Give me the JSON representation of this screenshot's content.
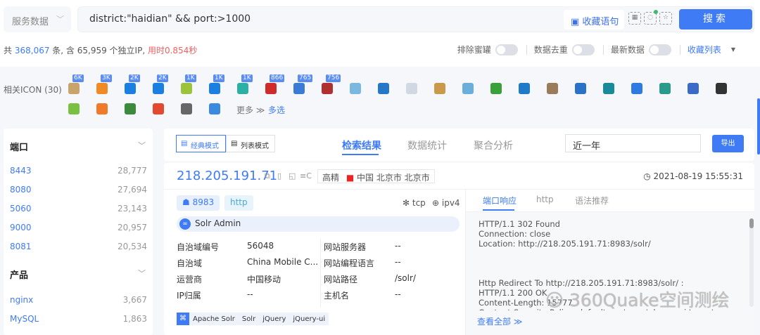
{
  "search": {
    "type_select": "服务数据",
    "query": "district:\"haidian\" && port:>1000",
    "fav_label": "收藏语句",
    "search_label": "搜索"
  },
  "stats": {
    "prefix": "共",
    "total": "368,067",
    "mid": "条, 含 65,959 个独立IP,",
    "time": "用时0.854秒"
  },
  "toggles": [
    {
      "label": "排除蜜罐",
      "on": false
    },
    {
      "label": "数据去重",
      "on": false
    },
    {
      "label": "最新数据",
      "on": false
    }
  ],
  "fav_list": "收藏列表",
  "icons": {
    "label": "相关ICON (30)",
    "more": "更多 ≫",
    "multi": "多选",
    "items": [
      {
        "badge": "6K",
        "color": "#c9a46a"
      },
      {
        "badge": "3K",
        "color": "#f08a24"
      },
      {
        "badge": "2K",
        "color": "#1a7fe0"
      },
      {
        "badge": "2K",
        "color": "#1a7fe0"
      },
      {
        "badge": "1K",
        "color": "#9bc43a"
      },
      {
        "badge": "1K",
        "color": "#1a7fe0"
      },
      {
        "badge": "1K",
        "color": "#2bb0a6"
      },
      {
        "badge": "866",
        "color": "#d02b2b"
      },
      {
        "badge": "765",
        "color": "#3a7bd5"
      },
      {
        "badge": "756",
        "color": "#b03030"
      },
      {
        "badge": "",
        "color": "#7ab8e0"
      },
      {
        "badge": "",
        "color": "#2577c8"
      },
      {
        "badge": "",
        "color": "#d0d8e4"
      },
      {
        "badge": "",
        "color": "#c89a4a"
      },
      {
        "badge": "",
        "color": "#6aaedc"
      },
      {
        "badge": "",
        "color": "#3aa03a"
      },
      {
        "badge": "",
        "color": "#1f7ac8"
      },
      {
        "badge": "",
        "color": "#9a7c5a"
      },
      {
        "badge": "",
        "color": "#2a72c8"
      },
      {
        "badge": "",
        "color": "#1a8a9a"
      },
      {
        "badge": "",
        "color": "#2d7be0"
      },
      {
        "badge": "",
        "color": "#2a9a8a"
      },
      {
        "badge": "",
        "color": "#3a6ac8"
      },
      {
        "badge": "",
        "color": "#333333"
      },
      {
        "badge": "",
        "color": "#7ac043"
      },
      {
        "badge": "",
        "color": "#f07a2a"
      },
      {
        "badge": "",
        "color": "#3c8a3c"
      },
      {
        "badge": "",
        "color": "#e2492f"
      },
      {
        "badge": "",
        "color": "#666666"
      },
      {
        "badge": "",
        "color": "#3a8ae0"
      }
    ]
  },
  "sidebar": {
    "port_title": "端口",
    "ports": [
      {
        "k": "8443",
        "v": "28,777"
      },
      {
        "k": "8080",
        "v": "27,694"
      },
      {
        "k": "5060",
        "v": "23,143"
      },
      {
        "k": "9000",
        "v": "20,957"
      },
      {
        "k": "8081",
        "v": "20,534"
      }
    ],
    "product_title": "产品",
    "products": [
      {
        "k": "nginx",
        "v": "3,667"
      },
      {
        "k": "MySQL",
        "v": "1,863"
      }
    ]
  },
  "toolbar": {
    "classic": "经典模式",
    "list": "列表模式",
    "tabs": [
      "检索结果",
      "数据统计",
      "聚合分析"
    ],
    "range": "近一年",
    "export": "导出"
  },
  "result": {
    "ip": "218.205.191.71",
    "precision": "高精",
    "location": "中国 北京市 北京市",
    "time": "2021-08-19 15:55:31",
    "port": "8983",
    "service": "http",
    "transport": "tcp",
    "ipver": "ipv4",
    "title": "Solr Admin",
    "left_kv": [
      {
        "k": "自治域编号",
        "v": "56048"
      },
      {
        "k": "自治域",
        "v": "China Mobile C..."
      },
      {
        "k": "运营商",
        "v": "中国移动"
      },
      {
        "k": "IP归属",
        "v": "--"
      }
    ],
    "right_kv": [
      {
        "k": "网站服务器",
        "v": "--"
      },
      {
        "k": "网站编程语言",
        "v": "--"
      },
      {
        "k": "网站路径",
        "v": "/solr/"
      },
      {
        "k": "主机名",
        "v": "--"
      }
    ],
    "techs": [
      "Apache Solr",
      "Solr",
      "jQuery",
      "jQuery-ui"
    ],
    "resp_tabs": [
      "端口响应",
      "http",
      "语法推荐"
    ],
    "response": "HTTP/1.1 302 Found\nConnection: close\nLocation: http://218.205.191.71:8983/solr/\n\n\n\nHttp Redirect To http://218.205.191.71:8983/solr/ :\nHTTP/1.1 200 OK\nContent-Length: 15777\nContent-Security-Policy: default-src 'none'; base-uri 'none'; connect-src",
    "view_all": "查看全部 ≫"
  },
  "watermark": "360Quake空间测绘",
  "colors": {
    "accent": "#3e7bf5",
    "time": "#f06060"
  }
}
